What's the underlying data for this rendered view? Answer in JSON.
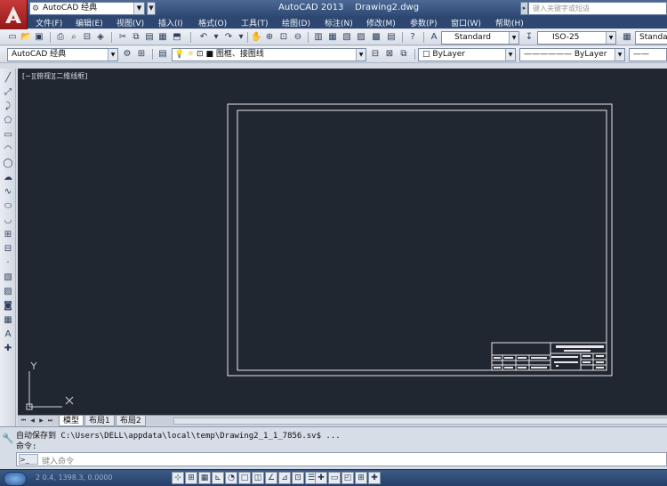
{
  "app": {
    "workspace": "AutoCAD 经典",
    "title": "AutoCAD 2013    Drawing2.dwg",
    "search_placeholder": "键入关键字或短语"
  },
  "menu": [
    "文件(F)",
    "编辑(E)",
    "视图(V)",
    "插入(I)",
    "格式(O)",
    "工具(T)",
    "绘图(D)",
    "标注(N)",
    "修改(M)",
    "参数(P)",
    "窗口(W)",
    "帮助(H)"
  ],
  "styles_toolbar": {
    "text_style": "Standard",
    "dim_style": "ISO-25",
    "table_style": "Standard"
  },
  "workspace_toolbar": {
    "workspace": "AutoCAD 经典",
    "layer": "图框、接图线",
    "color": "ByLayer",
    "linetype": "ByLayer",
    "lineweight": "——"
  },
  "viewport_label": "[−][俯视][二维线框]",
  "ucs": {
    "y": "Y",
    "x": "X"
  },
  "layout_tabs": [
    "模型",
    "布局1",
    "布局2"
  ],
  "command": {
    "history": [
      "自动保存到 C:\\Users\\DELL\\appdata\\local\\temp\\Drawing2_1_1_7856.sv$ ...",
      "命令:"
    ],
    "input_placeholder": "键入命令",
    "prompt_icon": ">_"
  },
  "status": {
    "coords": "2 0.4, 1398.3, 0.0000"
  },
  "colors": {
    "canvas": "#212731",
    "titlebar": "#2f4a74",
    "frame_line": "#e6e6e6"
  }
}
